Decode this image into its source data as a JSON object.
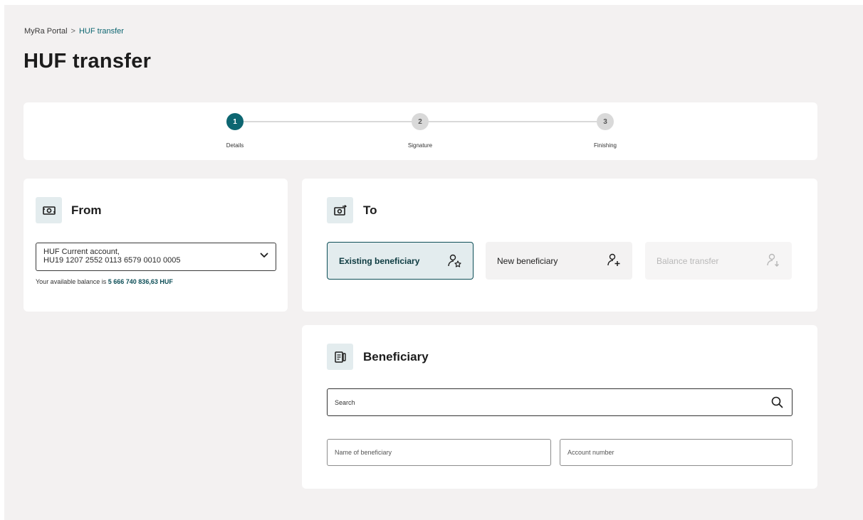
{
  "breadcrumb": {
    "root": "MyRa Portal",
    "separator": ">",
    "current": "HUF transfer"
  },
  "page_title": "HUF transfer",
  "stepper": {
    "steps": [
      {
        "number": "1",
        "label": "Details",
        "state": "active"
      },
      {
        "number": "2",
        "label": "Signature",
        "state": "inactive"
      },
      {
        "number": "3",
        "label": "Finishing",
        "state": "inactive"
      }
    ]
  },
  "from": {
    "title": "From",
    "icon": "banknote-icon",
    "account_line1": "HUF Current account,",
    "account_line2": "HU19 1207 2552 0113 6579 0010 0005",
    "balance_prefix": "Your available balance is",
    "balance_value": "5 666 740 836,63 HUF"
  },
  "to": {
    "title": "To",
    "icon": "banknote-transfer-icon",
    "options": [
      {
        "label": "Existing beneficiary",
        "icon": "user-star-icon",
        "state": "selected"
      },
      {
        "label": "New beneficiary",
        "icon": "user-plus-icon",
        "state": "default"
      },
      {
        "label": "Balance transfer",
        "icon": "user-down-icon",
        "state": "disabled"
      }
    ]
  },
  "beneficiary": {
    "title": "Beneficiary",
    "icon": "document-card-icon",
    "search_placeholder": "Search",
    "name_placeholder": "Name of beneficiary",
    "account_placeholder": "Account number"
  },
  "colors": {
    "accent": "#0d6671",
    "background": "#f3f1f1",
    "icon_bg": "#e3ecee"
  }
}
